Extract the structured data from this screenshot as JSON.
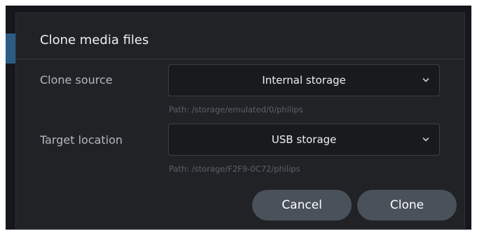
{
  "dialog": {
    "title": "Clone media files"
  },
  "source": {
    "label": "Clone source",
    "value": "Internal storage",
    "path": "Path: /storage/emulated/0/philips"
  },
  "target": {
    "label": "Target location",
    "value": "USB storage",
    "path": "Path: /storage/F2F9-0C72/philips"
  },
  "buttons": {
    "cancel": "Cancel",
    "clone": "Clone"
  },
  "icons": {
    "dropdown": "chevron-down-icon"
  },
  "colors": {
    "dialog_bg": "#212226",
    "field_bg": "#181a1d",
    "button_bg": "#49515b",
    "accent": "#2c5c86"
  }
}
